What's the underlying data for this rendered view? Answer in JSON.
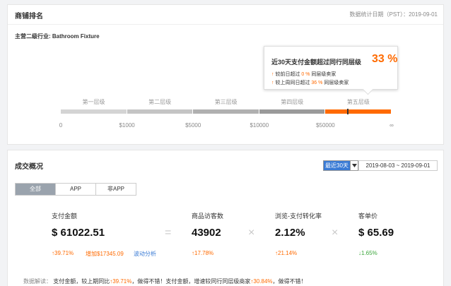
{
  "store_rank": {
    "title": "商铺排名",
    "stat_date": "数据统计日期（PST）：2019-09-01",
    "industry": "主营二级行业: Bathroom Fixture",
    "callout": {
      "headline": "近30天支付金额超过同行同层级",
      "percent": "33 %",
      "line1_prefix": "较前日超过",
      "line1_value": "0 %",
      "line1_suffix": "同层级卖家",
      "line2_prefix": "较上周同日超过",
      "line2_value": "36 %",
      "line2_suffix": "同层级卖家"
    },
    "tiers": [
      "第一层级",
      "第二层级",
      "第三层级",
      "第四层级",
      "第五层级"
    ],
    "tier_colors": [
      "#d4d4d4",
      "#c4c4c4",
      "#b0b0b0",
      "#9a9a9a",
      "#ff6a00"
    ],
    "active_tier_index": 4,
    "ticks": [
      "0",
      "$1000",
      "$5000",
      "$10000",
      "$50000",
      "∞"
    ]
  },
  "transactions": {
    "title": "成交概况",
    "period_select": "最近30天",
    "date_range": "2019-08-03 ~ 2019-09-01",
    "tabs": [
      {
        "label": "全部",
        "active": true
      },
      {
        "label": "APP",
        "active": false
      },
      {
        "label": "非APP",
        "active": false
      }
    ],
    "metrics": {
      "payment": {
        "label": "支付金额",
        "value": "$ 61022.51",
        "change": "↑39.71%",
        "increase": "增加$17345.09",
        "link": "波动分析"
      },
      "visitors": {
        "label": "商品访客数",
        "value": "43902",
        "change": "↑17.78%"
      },
      "conversion": {
        "label": "浏览-支付转化率",
        "value": "2.12%",
        "change": "↑21.14%"
      },
      "unit_price": {
        "label": "客单价",
        "value": "$ 65.69",
        "change": "↓1.65%"
      }
    },
    "operators": {
      "equals": "=",
      "times": "×"
    },
    "interpretation": {
      "label": "数据解读：",
      "part1": "支付金额，较上期同比",
      "part1_value": "↑39.71%",
      "part2": "，做得不错！支付金额，增速较同行同层级商家",
      "part2_value": "↑30.84%",
      "part3": "，做得不错！"
    }
  },
  "colors": {
    "accent": "#ff6a00",
    "decrease": "#3ca63c",
    "link": "#3a7bd5"
  }
}
